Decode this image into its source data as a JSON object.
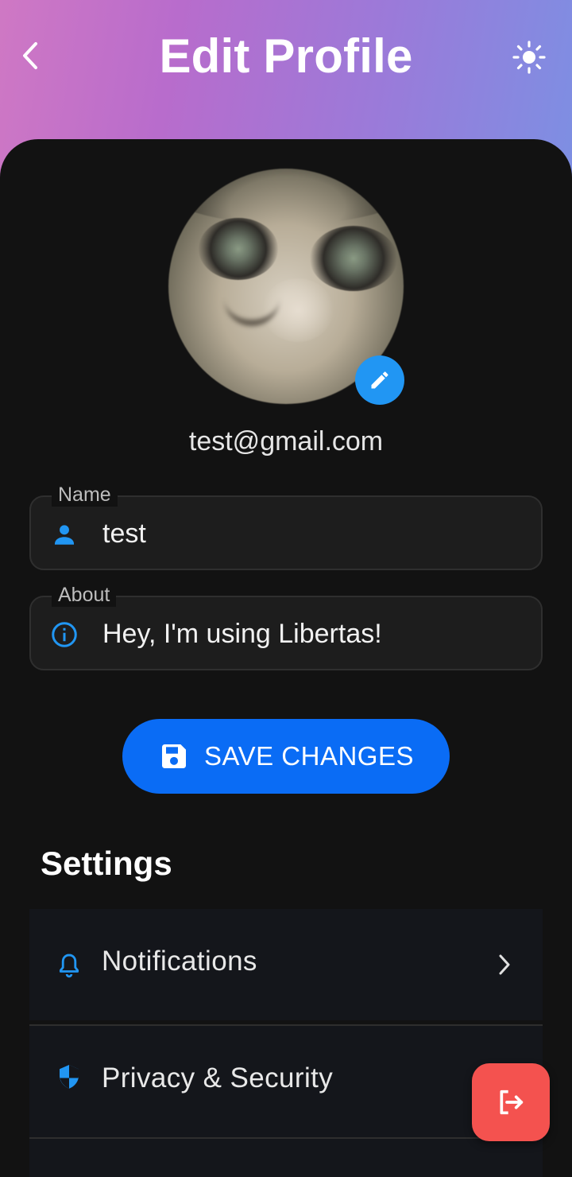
{
  "header": {
    "title": "Edit Profile",
    "back_icon": "chevron-left-icon",
    "theme_icon": "sun-icon",
    "gradient": [
      "#cf78c4",
      "#9b7ad9",
      "#7d8fe3"
    ]
  },
  "profile": {
    "email": "test@gmail.com",
    "edit_icon": "pencil-icon"
  },
  "form": {
    "name": {
      "label": "Name",
      "value": "test",
      "icon": "person-icon"
    },
    "about": {
      "label": "About",
      "value": "Hey, I'm using Libertas!",
      "icon": "info-icon"
    }
  },
  "save_button": {
    "label": "SAVE CHANGES",
    "icon": "save-icon",
    "color": "#0a6cf5"
  },
  "settings": {
    "title": "Settings",
    "items": [
      {
        "label": "Notifications",
        "icon": "bell-icon"
      },
      {
        "label": "Privacy & Security",
        "icon": "shield-icon"
      }
    ]
  },
  "fab": {
    "icon": "logout-icon",
    "color": "#f4524f"
  },
  "colors": {
    "accent": "#2196f3",
    "background": "#121212"
  }
}
